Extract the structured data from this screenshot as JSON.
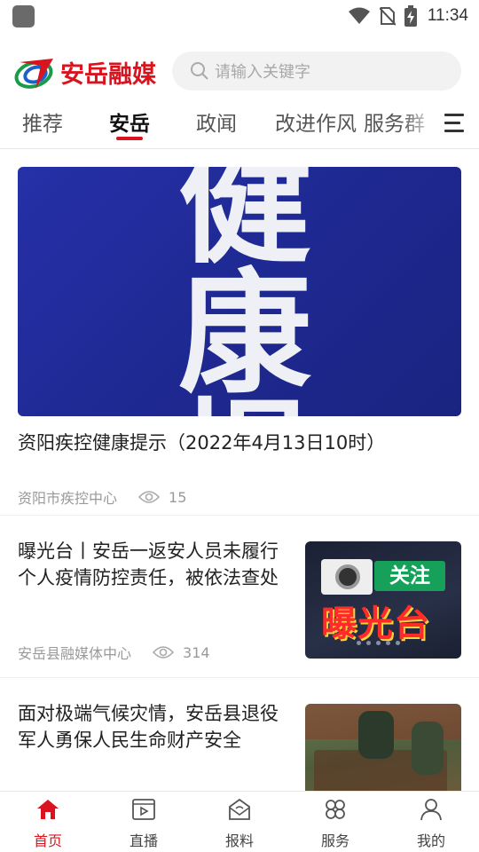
{
  "status_bar": {
    "time": "11:34",
    "icons": [
      "wifi-icon",
      "no-sim-icon",
      "battery-charging-icon"
    ]
  },
  "header": {
    "logo_text": "安岳融媒",
    "search_placeholder": "请输入关键字"
  },
  "tabs": [
    {
      "label": "推荐",
      "active": false
    },
    {
      "label": "安岳",
      "active": true
    },
    {
      "label": "政闻",
      "active": false
    },
    {
      "label": "改进作风",
      "active": false
    },
    {
      "label": "服务群",
      "active": false
    }
  ],
  "feed": {
    "hero": {
      "image_text": "健康提示",
      "title": "资阳疾控健康提示（2022年4月13日10时）",
      "source": "资阳市疾控中心",
      "views": "15"
    },
    "items": [
      {
        "title": "曝光台丨安岳一返安人员未履行个人疫情防控责任，被依法查处",
        "source": "安岳县融媒体中心",
        "views": "314",
        "thumb_text": {
          "badge": "关注",
          "headline": "曝光台"
        }
      },
      {
        "title": "面对极端气候灾情，安岳县退役军人勇保人民生命财产安全"
      }
    ]
  },
  "bottom_nav": [
    {
      "label": "首页",
      "icon": "home-icon",
      "active": true
    },
    {
      "label": "直播",
      "icon": "live-video-icon",
      "active": false
    },
    {
      "label": "报料",
      "icon": "report-mail-icon",
      "active": false
    },
    {
      "label": "服务",
      "icon": "services-icon",
      "active": false
    },
    {
      "label": "我的",
      "icon": "profile-icon",
      "active": false
    }
  ],
  "colors": {
    "accent": "#d9141f",
    "hero_bg": "#2630a8",
    "search_bg": "#f2f2f2"
  }
}
